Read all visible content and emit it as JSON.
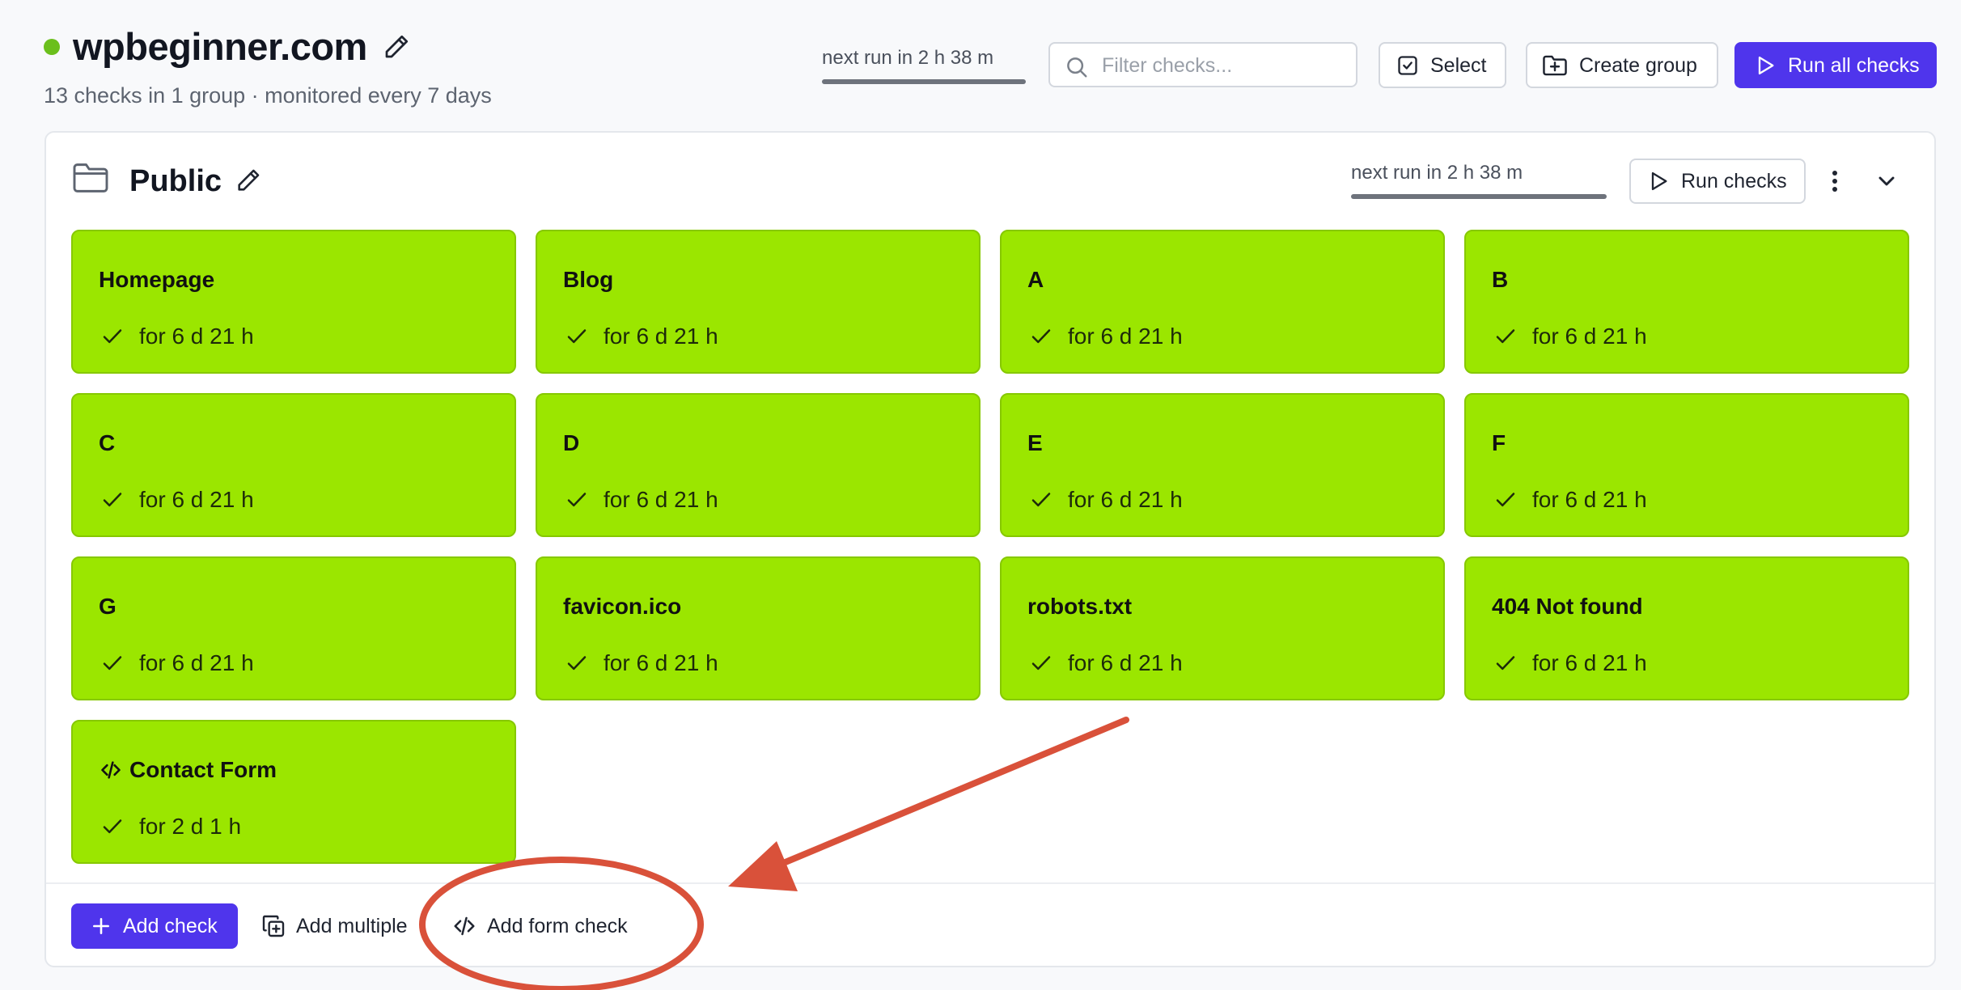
{
  "header": {
    "site_name": "wpbeginner.com",
    "site_status": "up",
    "subtitle": "13 checks in 1 group · monitored every 7 days",
    "next_run": "next run in 2 h 38 m",
    "filter_placeholder": "Filter checks...",
    "select_label": "Select",
    "create_group_label": "Create group",
    "run_all_label": "Run all checks"
  },
  "group": {
    "name": "Public",
    "next_run": "next run in 2 h 38 m",
    "run_label": "Run checks",
    "checks": [
      {
        "name": "Homepage",
        "status": "for 6 d 21 h",
        "icon": "check-icon"
      },
      {
        "name": "Blog",
        "status": "for 6 d 21 h",
        "icon": "check-icon"
      },
      {
        "name": "A",
        "status": "for 6 d 21 h",
        "icon": "check-icon"
      },
      {
        "name": "B",
        "status": "for 6 d 21 h",
        "icon": "check-icon"
      },
      {
        "name": "C",
        "status": "for 6 d 21 h",
        "icon": "check-icon"
      },
      {
        "name": "D",
        "status": "for 6 d 21 h",
        "icon": "check-icon"
      },
      {
        "name": "E",
        "status": "for 6 d 21 h",
        "icon": "check-icon"
      },
      {
        "name": "F",
        "status": "for 6 d 21 h",
        "icon": "check-icon"
      },
      {
        "name": "G",
        "status": "for 6 d 21 h",
        "icon": "check-icon"
      },
      {
        "name": "favicon.ico",
        "status": "for 6 d 21 h",
        "icon": "check-icon"
      },
      {
        "name": "robots.txt",
        "status": "for 6 d 21 h",
        "icon": "check-icon"
      },
      {
        "name": "404 Not found",
        "status": "for 6 d 21 h",
        "icon": "check-icon"
      },
      {
        "name": "Contact Form",
        "status": "for 2 d 1 h",
        "icon": "check-icon",
        "type_icon": "code-icon"
      }
    ],
    "add_check_label": "Add check",
    "add_multiple_label": "Add multiple",
    "add_form_check_label": "Add form check"
  },
  "colors": {
    "accent": "#4f35ec",
    "check_ok": "#9be600",
    "status_dot": "#6bbf1c",
    "annotation": "#d9513a"
  }
}
